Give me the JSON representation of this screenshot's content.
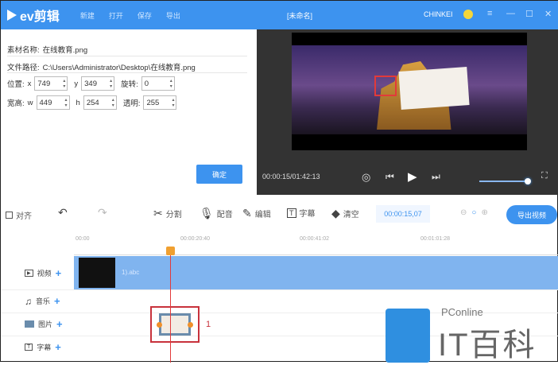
{
  "titlebar": {
    "app_name": "ev剪辑",
    "menu": [
      "新建",
      "打开",
      "保存",
      "导出"
    ],
    "document": "[未命名]",
    "user": "CHINKEI",
    "controls": {
      "settings": "≡",
      "minimize": "—",
      "maximize": "☐",
      "close": "✕"
    }
  },
  "properties": {
    "name_label": "素材名称:",
    "name_value": "在线教育.png",
    "path_label": "文件路径:",
    "path_value": "C:\\Users\\Administrator\\Desktop\\在线教育.png",
    "position_label": "位置:",
    "x_label": "x",
    "x_value": "749",
    "y_label": "y",
    "y_value": "349",
    "rotate_label": "旋转:",
    "rotate_value": "0",
    "size_label": "宽高:",
    "w_label": "w",
    "w_value": "449",
    "h_label": "h",
    "h_value": "254",
    "opacity_label": "透明:",
    "opacity_value": "255",
    "confirm_button": "确定"
  },
  "player": {
    "time": "00:00:15/01:42:13",
    "volume_percent": 100
  },
  "toolbar": {
    "align": "对齐",
    "split": "分割",
    "dub": "配音",
    "edit": "编辑",
    "subtitle": "字幕",
    "clear": "清空",
    "current_time": "00:00:15,07",
    "export": "导出视频"
  },
  "timeline": {
    "ruler": [
      "00:00",
      "00:00:20:40",
      "00:00:41:02",
      "00:01:01:28"
    ],
    "tracks": [
      {
        "label": "视频",
        "icon": "video-icon"
      },
      {
        "label": "音乐",
        "icon": "music-icon"
      },
      {
        "label": "图片",
        "icon": "image-icon"
      },
      {
        "label": "字幕",
        "icon": "subtitle-icon"
      }
    ],
    "video_clip_name": "1).abc",
    "image_clip_index": "1"
  },
  "watermark": {
    "brand": "PConline",
    "name": "IT百科"
  }
}
